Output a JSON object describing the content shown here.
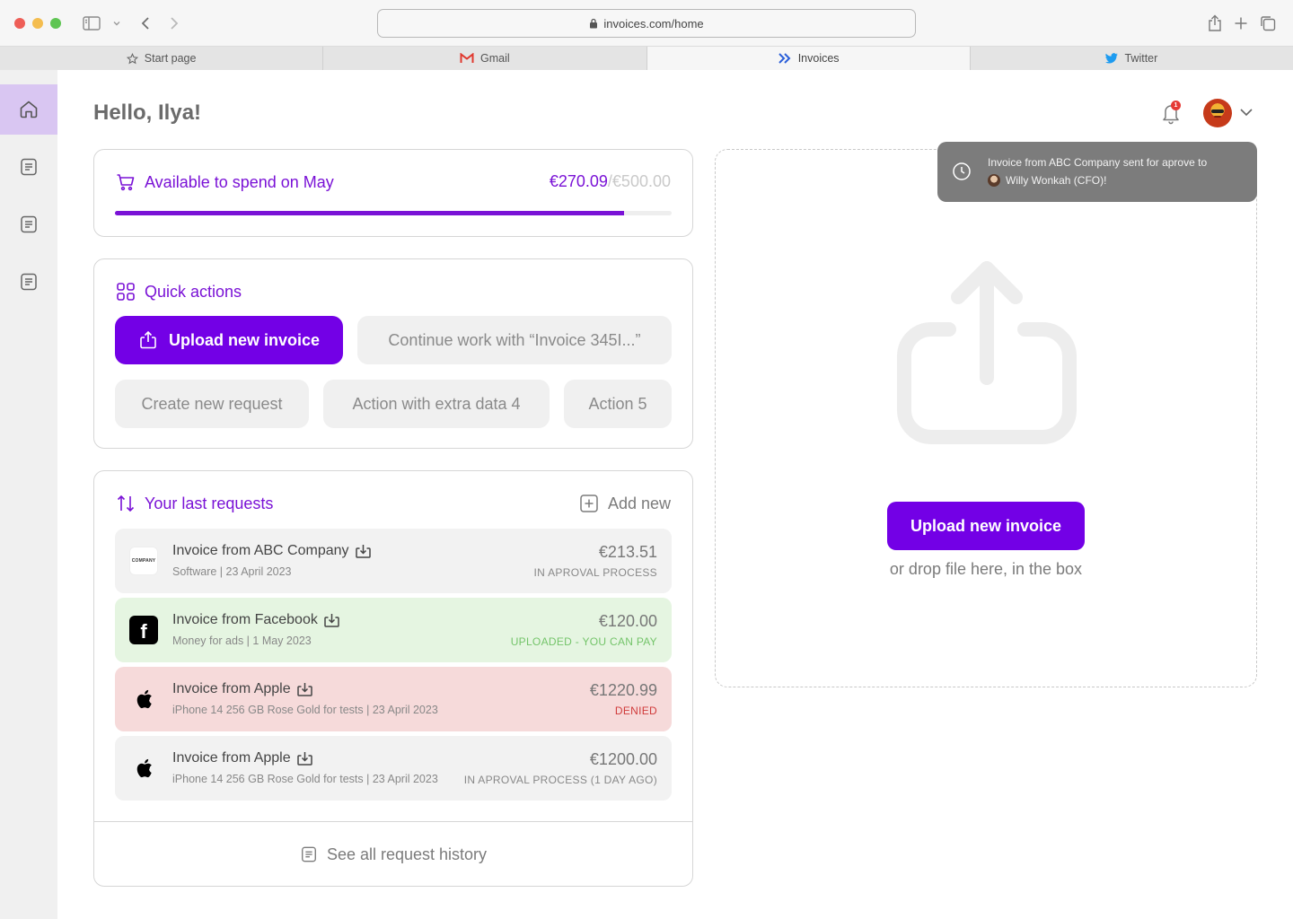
{
  "browser": {
    "url": "invoices.com/home",
    "tabs": [
      {
        "label": "Start page",
        "icon": "star-icon"
      },
      {
        "label": "Gmail",
        "icon": "gmail-icon"
      },
      {
        "label": "Invoices",
        "icon": "invoices-logo-icon"
      },
      {
        "label": "Twitter",
        "icon": "twitter-icon"
      }
    ]
  },
  "header": {
    "greeting": "Hello, Ilya!",
    "notification_count": "1"
  },
  "budget": {
    "label": "Available to spend on May",
    "spent": "€270.09",
    "total": "/€500.00",
    "progress": 0.915
  },
  "quick_actions": {
    "title": "Quick actions",
    "primary_label": "Upload new invoice",
    "continue_label": "Continue work with “Invoice 345I...”",
    "create_label": "Create new request",
    "action4_label": "Action with extra data 4",
    "action5_label": "Action 5"
  },
  "requests": {
    "title": "Your last requests",
    "add_new_label": "Add new",
    "items": [
      {
        "title": "Invoice from ABC Company",
        "subtitle": "Software | 23 April 2023",
        "amount": "€213.51",
        "status": "IN APROVAL PROCESS",
        "variant": "neutral",
        "logo_text": "COMPANY"
      },
      {
        "title": "Invoice from Facebook",
        "subtitle": "Money for ads | 1 May 2023",
        "amount": "€120.00",
        "status": "UPLOADED - YOU CAN PAY",
        "variant": "green",
        "logo_text": "f"
      },
      {
        "title": "Invoice from Apple",
        "subtitle": "iPhone 14 256 GB Rose Gold for tests | 23 April 2023",
        "amount": "€1220.99",
        "status": "DENIED",
        "variant": "red"
      },
      {
        "title": "Invoice from Apple",
        "subtitle": "iPhone 14 256 GB Rose Gold for tests | 23 April 2023",
        "amount": "€1200.00",
        "status": "IN APROVAL PROCESS (1 DAY AGO)",
        "variant": "neutral"
      }
    ],
    "history_label": "See all request history"
  },
  "dropzone": {
    "button_label": "Upload new invoice",
    "hint": "or drop file here, in the box"
  },
  "toast": {
    "line1": "Invoice from ABC Company sent for aprove to",
    "line2": "Willy Wonkah (CFO)!"
  },
  "colors": {
    "accent": "#7300e6",
    "accent_text": "#7a12d6",
    "success": "#74c46a",
    "danger": "#d03a3a"
  }
}
